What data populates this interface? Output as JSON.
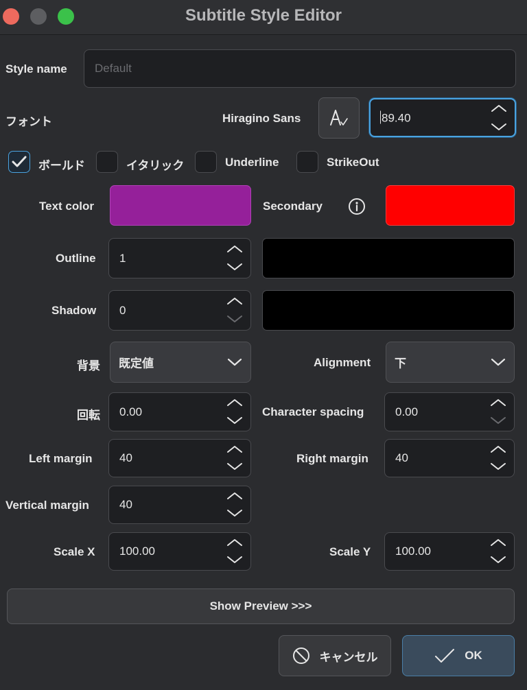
{
  "window": {
    "title": "Subtitle Style Editor"
  },
  "style_name": {
    "label": "Style name",
    "placeholder": "Default",
    "value": ""
  },
  "font": {
    "label": "フォント",
    "name": "Hiragino Sans",
    "size": "89.40",
    "picker_icon": "font-picker-icon"
  },
  "checkboxes": [
    {
      "label": "ボールド",
      "checked": true
    },
    {
      "label": "イタリック",
      "checked": false
    },
    {
      "label": "Underline",
      "checked": false
    },
    {
      "label": "StrikeOut",
      "checked": false
    }
  ],
  "text_color": {
    "label": "Text color",
    "color": "#95209a"
  },
  "secondary": {
    "label": "Secondary",
    "info_icon": "info-icon",
    "color": "#ff0000"
  },
  "outline": {
    "label": "Outline",
    "value": "1",
    "color": "#000000"
  },
  "shadow": {
    "label": "Shadow",
    "value": "0",
    "color": "#000000"
  },
  "background": {
    "label": "背景",
    "value": "既定値"
  },
  "alignment": {
    "label": "Alignment",
    "value": "下"
  },
  "rotation": {
    "label": "回転",
    "value": "0.00"
  },
  "character_spacing": {
    "label": "Character spacing",
    "value": "0.00"
  },
  "left_margin": {
    "label": "Left margin",
    "value": "40"
  },
  "right_margin": {
    "label": "Right margin",
    "value": "40"
  },
  "vertical_margin": {
    "label": "Vertical margin",
    "value": "40"
  },
  "scale_x": {
    "label": "Scale X",
    "value": "100.00"
  },
  "scale_y": {
    "label": "Scale Y",
    "value": "100.00"
  },
  "buttons": {
    "preview": "Show Preview >>>",
    "cancel": "キャンセル",
    "ok": "OK"
  },
  "colors": {
    "accent": "#4aa3e0",
    "window_bg": "#2b2c2f",
    "field_bg": "#1e1f22"
  }
}
